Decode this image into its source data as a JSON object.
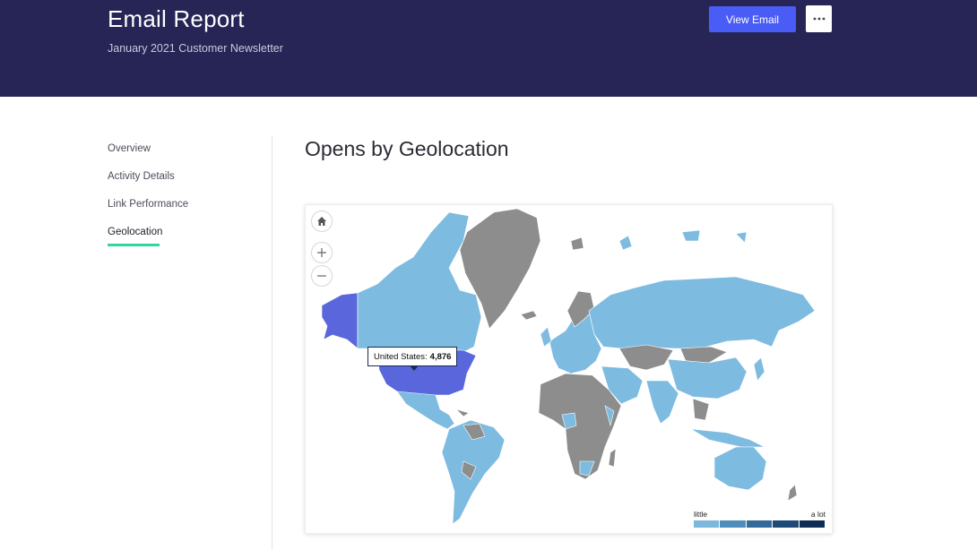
{
  "header": {
    "title": "Email Report",
    "subtitle": "January 2021 Customer Newsletter",
    "view_email_label": "View Email",
    "more_icon": "ellipsis-icon"
  },
  "sidebar": {
    "items": [
      {
        "label": "Overview",
        "active": false
      },
      {
        "label": "Activity Details",
        "active": false
      },
      {
        "label": "Link Performance",
        "active": false
      },
      {
        "label": "Geolocation",
        "active": true
      }
    ]
  },
  "main": {
    "section_title": "Opens by Geolocation",
    "map": {
      "controls": [
        "home-icon",
        "zoom-in-icon",
        "zoom-out-icon"
      ],
      "tooltip": {
        "country": "United States:",
        "value": "4,876"
      },
      "legend": {
        "low_label": "little",
        "high_label": "a lot",
        "scale_colors": [
          "#7cb7dc",
          "#4f8dbb",
          "#346a99",
          "#1f4a78",
          "#0f2c55"
        ]
      },
      "colors": {
        "no_data": "#8d8d8d",
        "low": "#7dbbe0",
        "highlight": "#5a67dc",
        "water": "#ffffff"
      }
    }
  },
  "colors": {
    "header_bg": "#262556",
    "primary_button": "#4a5cf6",
    "active_indicator": "#2fd6a2"
  }
}
